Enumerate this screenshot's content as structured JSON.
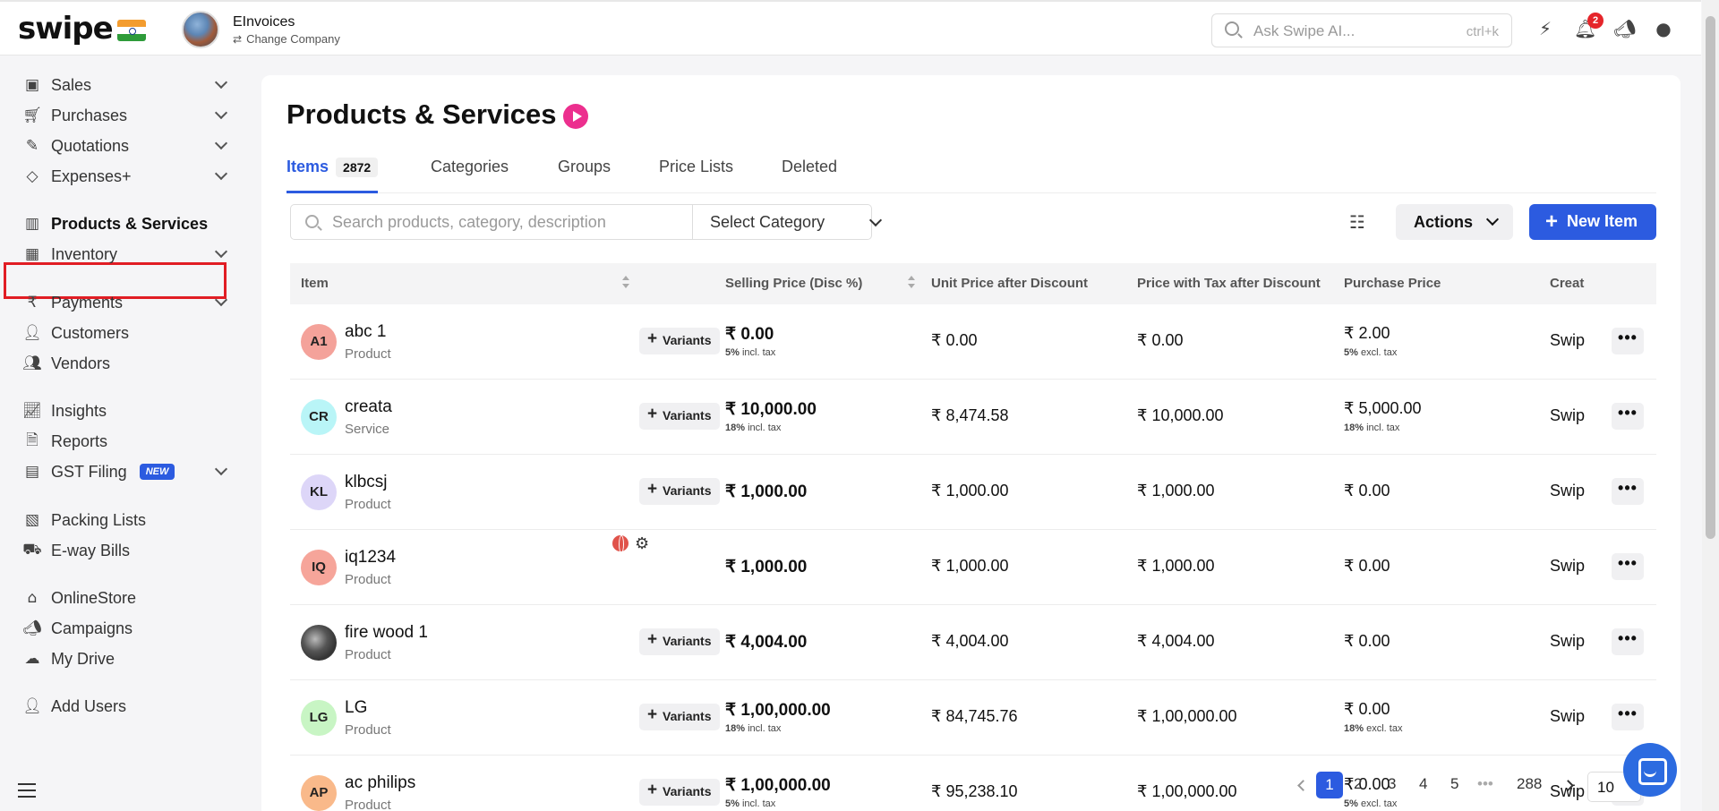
{
  "app": {
    "logo": "swipe",
    "company_name": "EInvoices",
    "change_company": "Change Company"
  },
  "topbar": {
    "search_placeholder": "Ask Swipe AI...",
    "search_shortcut": "ctrl+k",
    "notification_count": "2"
  },
  "sidebar": {
    "items": [
      {
        "label": "Sales",
        "icon": "cash-icon"
      },
      {
        "label": "Purchases",
        "icon": "cart-icon"
      },
      {
        "label": "Quotations",
        "icon": "pencil-icon"
      },
      {
        "label": "Expenses+",
        "icon": "tag-icon"
      },
      {
        "label": "Products & Services",
        "icon": "barcode-icon"
      },
      {
        "label": "Inventory",
        "icon": "box-icon"
      },
      {
        "label": "Payments",
        "icon": "rupee-icon"
      },
      {
        "label": "Customers",
        "icon": "user-icon"
      },
      {
        "label": "Vendors",
        "icon": "users-icon"
      },
      {
        "label": "Insights",
        "icon": "chart-icon"
      },
      {
        "label": "Reports",
        "icon": "document-icon"
      },
      {
        "label": "GST Filing",
        "icon": "file-icon",
        "badge": "NEW"
      },
      {
        "label": "Packing Lists",
        "icon": "package-icon"
      },
      {
        "label": "E-way Bills",
        "icon": "truck-icon"
      },
      {
        "label": "OnlineStore",
        "icon": "store-icon"
      },
      {
        "label": "Campaigns",
        "icon": "megaphone-icon"
      },
      {
        "label": "My Drive",
        "icon": "cloud-icon"
      },
      {
        "label": "Add Users",
        "icon": "user-plus-icon"
      }
    ]
  },
  "main": {
    "title": "Products & Services",
    "tabs": [
      {
        "label": "Items",
        "count": "2872"
      },
      {
        "label": "Categories"
      },
      {
        "label": "Groups"
      },
      {
        "label": "Price Lists"
      },
      {
        "label": "Deleted"
      }
    ],
    "search_placeholder": "Search products, category, description",
    "category_select": "Select Category",
    "actions_label": "Actions",
    "new_item_label": "New Item",
    "columns": [
      "Item",
      "Selling Price (Disc %)",
      "Unit Price after Discount",
      "Price with Tax after Discount",
      "Purchase Price",
      "Creat"
    ],
    "variants_label": "Variants",
    "rows": [
      {
        "initials": "A1",
        "avatar_color": "#f4a29a",
        "name": "abc 1",
        "type": "Product",
        "selling": "₹ 0.00",
        "selling_tax_pct": "5%",
        "selling_tax_note": "incl. tax",
        "unit": "₹ 0.00",
        "with_tax": "₹ 0.00",
        "purchase": "₹ 2.00",
        "purchase_tax_pct": "5%",
        "purchase_tax_note": "excl. tax",
        "created": "Swip"
      },
      {
        "initials": "CR",
        "avatar_color": "#b9f5f7",
        "name": "creata",
        "type": "Service",
        "selling": "₹ 10,000.00",
        "selling_tax_pct": "18%",
        "selling_tax_note": "incl. tax",
        "unit": "₹ 8,474.58",
        "with_tax": "₹ 10,000.00",
        "purchase": "₹ 5,000.00",
        "purchase_tax_pct": "18%",
        "purchase_tax_note": "incl. tax",
        "created": "Swip"
      },
      {
        "initials": "KL",
        "avatar_color": "#ddd6f8",
        "name": "klbcsj",
        "type": "Product",
        "selling": "₹ 1,000.00",
        "unit": "₹ 1,000.00",
        "with_tax": "₹ 1,000.00",
        "purchase": "₹ 0.00",
        "created": "Swip"
      },
      {
        "initials": "IQ",
        "avatar_color": "#f6a59a",
        "name": "iq1234",
        "type": "Product",
        "selling": "₹ 1,000.00",
        "unit": "₹ 1,000.00",
        "with_tax": "₹ 1,000.00",
        "purchase": "₹ 0.00",
        "created": "Swip"
      },
      {
        "initials": "",
        "avatar_color": "#777777",
        "name": "fire wood 1",
        "type": "Product",
        "selling": "₹ 4,004.00",
        "unit": "₹ 4,004.00",
        "with_tax": "₹ 4,004.00",
        "purchase": "₹ 0.00",
        "created": "Swip"
      },
      {
        "initials": "LG",
        "avatar_color": "#c8f5c4",
        "name": "LG",
        "type": "Product",
        "selling": "₹ 1,00,000.00",
        "selling_tax_pct": "18%",
        "selling_tax_note": "incl. tax",
        "unit": "₹ 84,745.76",
        "with_tax": "₹ 1,00,000.00",
        "purchase": "₹ 0.00",
        "purchase_tax_pct": "18%",
        "purchase_tax_note": "excl. tax",
        "created": "Swip"
      },
      {
        "initials": "AP",
        "avatar_color": "#f9b98a",
        "name": "ac philips",
        "type": "Product",
        "selling": "₹ 1,00,000.00",
        "selling_tax_pct": "5%",
        "selling_tax_note": "incl. tax",
        "unit": "₹ 95,238.10",
        "with_tax": "₹ 1,00,000.00",
        "purchase": "₹ 0.00",
        "purchase_tax_pct": "5%",
        "purchase_tax_note": "excl. tax",
        "created": "Swip"
      }
    ]
  },
  "pagination": {
    "pages": [
      "1",
      "2",
      "3",
      "4",
      "5",
      "288"
    ],
    "ellipsis": "•••",
    "page_size": "10"
  }
}
